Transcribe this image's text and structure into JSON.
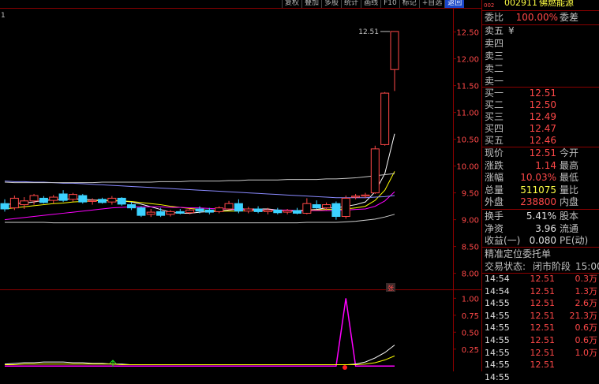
{
  "toolbar": {
    "items": [
      "复权",
      "叠加",
      "多股",
      "统计",
      "画线",
      "F10",
      "标记",
      "+自选",
      "返回"
    ],
    "active_index": 8
  },
  "chart_data": [
    {
      "type": "candlestick",
      "y_ticks": [
        "12.50",
        "12.00",
        "11.50",
        "11.00",
        "10.50",
        "10.00",
        "9.50",
        "9.00",
        "8.50",
        "8.00"
      ],
      "ylim": [
        7.7,
        12.95
      ],
      "price_annotation": "12.51",
      "left_label": "1",
      "marker_label": "张",
      "candles": [
        {
          "o": 9.3,
          "h": 9.38,
          "l": 9.15,
          "c": 9.2
        },
        {
          "o": 9.22,
          "h": 9.45,
          "l": 9.18,
          "c": 9.4
        },
        {
          "o": 9.28,
          "h": 9.42,
          "l": 9.2,
          "c": 9.35
        },
        {
          "o": 9.35,
          "h": 9.48,
          "l": 9.28,
          "c": 9.45
        },
        {
          "o": 9.4,
          "h": 9.44,
          "l": 9.3,
          "c": 9.32
        },
        {
          "o": 9.36,
          "h": 9.46,
          "l": 9.3,
          "c": 9.42
        },
        {
          "o": 9.48,
          "h": 9.55,
          "l": 9.33,
          "c": 9.36
        },
        {
          "o": 9.38,
          "h": 9.5,
          "l": 9.34,
          "c": 9.47
        },
        {
          "o": 9.45,
          "h": 9.48,
          "l": 9.3,
          "c": 9.33
        },
        {
          "o": 9.34,
          "h": 9.4,
          "l": 9.28,
          "c": 9.36
        },
        {
          "o": 9.38,
          "h": 9.41,
          "l": 9.3,
          "c": 9.32
        },
        {
          "o": 9.33,
          "h": 9.44,
          "l": 9.28,
          "c": 9.4
        },
        {
          "o": 9.4,
          "h": 9.42,
          "l": 9.26,
          "c": 9.29
        },
        {
          "o": 9.28,
          "h": 9.33,
          "l": 9.18,
          "c": 9.22
        },
        {
          "o": 9.22,
          "h": 9.25,
          "l": 9.05,
          "c": 9.08
        },
        {
          "o": 9.1,
          "h": 9.2,
          "l": 9.05,
          "c": 9.14
        },
        {
          "o": 9.15,
          "h": 9.22,
          "l": 9.05,
          "c": 9.08
        },
        {
          "o": 9.1,
          "h": 9.18,
          "l": 9.06,
          "c": 9.15
        },
        {
          "o": 9.15,
          "h": 9.2,
          "l": 9.1,
          "c": 9.12
        },
        {
          "o": 9.13,
          "h": 9.2,
          "l": 9.1,
          "c": 9.18
        },
        {
          "o": 9.2,
          "h": 9.25,
          "l": 9.12,
          "c": 9.16
        },
        {
          "o": 9.18,
          "h": 9.22,
          "l": 9.1,
          "c": 9.14
        },
        {
          "o": 9.15,
          "h": 9.25,
          "l": 9.12,
          "c": 9.22
        },
        {
          "o": 9.2,
          "h": 9.35,
          "l": 9.18,
          "c": 9.3
        },
        {
          "o": 9.3,
          "h": 9.38,
          "l": 9.12,
          "c": 9.16
        },
        {
          "o": 9.16,
          "h": 9.24,
          "l": 9.12,
          "c": 9.2
        },
        {
          "o": 9.2,
          "h": 9.25,
          "l": 9.12,
          "c": 9.15
        },
        {
          "o": 9.15,
          "h": 9.22,
          "l": 9.1,
          "c": 9.18
        },
        {
          "o": 9.18,
          "h": 9.22,
          "l": 9.1,
          "c": 9.13
        },
        {
          "o": 9.14,
          "h": 9.2,
          "l": 9.1,
          "c": 9.17
        },
        {
          "o": 9.17,
          "h": 9.22,
          "l": 9.1,
          "c": 9.12
        },
        {
          "o": 9.12,
          "h": 9.4,
          "l": 9.1,
          "c": 9.3
        },
        {
          "o": 9.28,
          "h": 9.36,
          "l": 9.2,
          "c": 9.22
        },
        {
          "o": 9.22,
          "h": 9.32,
          "l": 9.18,
          "c": 9.28
        },
        {
          "o": 9.3,
          "h": 9.34,
          "l": 9.0,
          "c": 9.06
        },
        {
          "o": 9.06,
          "h": 9.45,
          "l": 9.02,
          "c": 9.4
        },
        {
          "o": 9.42,
          "h": 9.48,
          "l": 9.38,
          "c": 9.44
        },
        {
          "o": 9.44,
          "h": 9.5,
          "l": 9.4,
          "c": 9.46
        },
        {
          "o": 9.5,
          "h": 10.38,
          "l": 9.48,
          "c": 10.32
        },
        {
          "o": 10.4,
          "h": 11.38,
          "l": 10.38,
          "c": 11.36
        },
        {
          "o": 11.8,
          "h": 12.51,
          "l": 11.4,
          "c": 12.51
        }
      ],
      "ma_lines": [
        {
          "name": "MA5",
          "color": "#ffffff",
          "values": [
            9.28,
            9.3,
            9.31,
            9.33,
            9.36,
            9.37,
            9.38,
            9.39,
            9.38,
            9.37,
            9.36,
            9.35,
            9.35,
            9.33,
            9.29,
            9.24,
            9.19,
            9.14,
            9.12,
            9.12,
            9.14,
            9.15,
            9.16,
            9.18,
            9.2,
            9.2,
            9.2,
            9.2,
            9.18,
            9.17,
            9.15,
            9.18,
            9.19,
            9.22,
            9.22,
            9.25,
            9.28,
            9.33,
            9.52,
            9.86,
            10.6
          ]
        },
        {
          "name": "MA10",
          "color": "#ffff00",
          "values": [
            9.2,
            9.22,
            9.24,
            9.26,
            9.28,
            9.3,
            9.31,
            9.33,
            9.34,
            9.35,
            9.36,
            9.36,
            9.35,
            9.34,
            9.32,
            9.3,
            9.28,
            9.25,
            9.23,
            9.21,
            9.19,
            9.17,
            9.16,
            9.16,
            9.16,
            9.17,
            9.17,
            9.17,
            9.17,
            9.17,
            9.17,
            9.18,
            9.18,
            9.19,
            9.19,
            9.2,
            9.22,
            9.25,
            9.36,
            9.55,
            9.9
          ]
        },
        {
          "name": "MA20",
          "color": "#ff00ff",
          "values": [
            9.0,
            9.02,
            9.04,
            9.06,
            9.08,
            9.1,
            9.12,
            9.14,
            9.16,
            9.18,
            9.2,
            9.22,
            9.23,
            9.24,
            9.24,
            9.24,
            9.24,
            9.23,
            9.23,
            9.22,
            9.22,
            9.21,
            9.2,
            9.2,
            9.19,
            9.19,
            9.18,
            9.18,
            9.18,
            9.18,
            9.17,
            9.17,
            9.17,
            9.17,
            9.17,
            9.18,
            9.19,
            9.2,
            9.25,
            9.35,
            9.52
          ]
        },
        {
          "name": "MA30",
          "color": "#8a8aff",
          "values": [
            9.72,
            9.71,
            9.71,
            9.7,
            9.7,
            9.69,
            9.68,
            9.68,
            9.67,
            9.66,
            9.65,
            9.64,
            9.63,
            9.62,
            9.61,
            9.6,
            9.59,
            9.58,
            9.57,
            9.56,
            9.55,
            9.54,
            9.53,
            9.52,
            9.51,
            9.5,
            9.49,
            9.48,
            9.47,
            9.46,
            9.45,
            9.44,
            9.43,
            9.42,
            9.41,
            9.41,
            9.41,
            9.41,
            9.42,
            9.43,
            9.45
          ]
        },
        {
          "name": "MA60",
          "color": "#c8c8c8",
          "values": [
            9.7,
            9.69,
            9.69,
            9.69,
            9.69,
            9.69,
            9.69,
            9.69,
            9.69,
            9.69,
            9.7,
            9.7,
            9.7,
            9.7,
            9.7,
            9.7,
            9.71,
            9.71,
            9.71,
            9.72,
            9.72,
            9.72,
            9.72,
            9.73,
            9.73,
            9.74,
            9.74,
            9.74,
            9.74,
            9.75,
            9.75,
            9.75,
            9.75,
            9.76,
            9.76,
            9.77,
            9.78,
            9.8,
            9.82,
            9.84,
            9.86
          ]
        },
        {
          "name": "MA120",
          "color": "#d0d0d0",
          "values": [
            8.95,
            8.95,
            8.95,
            8.95,
            8.95,
            8.94,
            8.94,
            8.94,
            8.94,
            8.94,
            8.94,
            8.94,
            8.94,
            8.94,
            8.94,
            8.94,
            8.94,
            8.94,
            8.94,
            8.94,
            8.94,
            8.94,
            8.94,
            8.94,
            8.94,
            8.94,
            8.94,
            8.94,
            8.94,
            8.94,
            8.94,
            8.95,
            8.95,
            8.95,
            8.95,
            8.96,
            8.97,
            8.99,
            9.01,
            9.05,
            9.1
          ]
        }
      ]
    },
    {
      "type": "line",
      "y_ticks": [
        "1.00",
        "0.75",
        "0.50",
        "0.25"
      ],
      "ylim": [
        -0.02,
        1.12
      ],
      "series": [
        {
          "color": "#ff00ff",
          "values": [
            0,
            0,
            0,
            0,
            0,
            0,
            0,
            0,
            0,
            0,
            0,
            0,
            0,
            0,
            0,
            0,
            0,
            0,
            0,
            0,
            0,
            0,
            0,
            0,
            0,
            0,
            0,
            0,
            0,
            0,
            0,
            0,
            0,
            0,
            0,
            1.0,
            0,
            0,
            0,
            0,
            0
          ]
        },
        {
          "color": "#ffffff",
          "values": [
            0.03,
            0.04,
            0.05,
            0.05,
            0.06,
            0.06,
            0.06,
            0.05,
            0.05,
            0.04,
            0.04,
            0.03,
            0.03,
            0.02,
            0.02,
            0.02,
            0.02,
            0.02,
            0.02,
            0.02,
            0.02,
            0.02,
            0.02,
            0.02,
            0.02,
            0.02,
            0.02,
            0.02,
            0.02,
            0.02,
            0.02,
            0.02,
            0.02,
            0.02,
            0.02,
            0.02,
            0.03,
            0.06,
            0.12,
            0.2,
            0.31
          ]
        },
        {
          "color": "#ffff00",
          "values": [
            0.02,
            0.02,
            0.03,
            0.03,
            0.03,
            0.03,
            0.03,
            0.03,
            0.03,
            0.03,
            0.03,
            0.03,
            0.02,
            0.02,
            0.02,
            0.02,
            0.02,
            0.02,
            0.02,
            0.02,
            0.02,
            0.02,
            0.02,
            0.02,
            0.02,
            0.02,
            0.02,
            0.02,
            0.02,
            0.02,
            0.02,
            0.02,
            0.02,
            0.02,
            0.02,
            0.02,
            0.02,
            0.03,
            0.05,
            0.09,
            0.15
          ]
        }
      ]
    }
  ],
  "quote": {
    "stock_code": "002911",
    "stock_name": "佛燃能源",
    "weibi_label": "委比",
    "weibi_value": "100.00%",
    "weicha_label": "委差",
    "sell_levels": [
      {
        "label": "卖五",
        "price": "",
        "vol": "¥"
      },
      {
        "label": "卖四",
        "price": "",
        "vol": ""
      },
      {
        "label": "卖三",
        "price": "",
        "vol": ""
      },
      {
        "label": "卖二",
        "price": "",
        "vol": ""
      },
      {
        "label": "卖一",
        "price": "",
        "vol": ""
      }
    ],
    "buy_levels": [
      {
        "label": "买一",
        "price": "12.51"
      },
      {
        "label": "买二",
        "price": "12.50"
      },
      {
        "label": "买三",
        "price": "12.49"
      },
      {
        "label": "买四",
        "price": "12.47"
      },
      {
        "label": "买五",
        "price": "12.46"
      }
    ],
    "stats": [
      {
        "l": "现价",
        "v": "12.51",
        "vc": "red",
        "r": "今开"
      },
      {
        "l": "涨跌",
        "v": "1.14",
        "vc": "red",
        "r": "最高"
      },
      {
        "l": "涨幅",
        "v": "10.03%",
        "vc": "red",
        "r": "最低"
      },
      {
        "l": "总量",
        "v": "511075",
        "vc": "yel",
        "r": "量比"
      },
      {
        "l": "外盘",
        "v": "238800",
        "vc": "red",
        "r": "内盘"
      }
    ],
    "stats2": [
      {
        "l": "换手",
        "v": "5.41%",
        "vc": "wh",
        "r": "股本"
      },
      {
        "l": "净资",
        "v": "3.96",
        "vc": "wh",
        "r": "流通"
      },
      {
        "l": "收益(一)",
        "v": "0.080",
        "vc": "wh",
        "r": "PE(动)"
      }
    ],
    "section_title": "精准定位委托单",
    "trade_status_label": "交易状态:",
    "trade_status_value": "闭市阶段",
    "trade_status_time": "15:00:0",
    "ticks": [
      {
        "t": "14:54",
        "p": "12.51",
        "v": "0.3万"
      },
      {
        "t": "14:54",
        "p": "12.51",
        "v": "1.3万"
      },
      {
        "t": "14:55",
        "p": "12.51",
        "v": "2.6万"
      },
      {
        "t": "14:55",
        "p": "12.51",
        "v": "21.3万"
      },
      {
        "t": "14:55",
        "p": "12.51",
        "v": "0.6万"
      },
      {
        "t": "14:55",
        "p": "12.51",
        "v": "0.6万"
      },
      {
        "t": "14:55",
        "p": "12.51",
        "v": "1.0万"
      },
      {
        "t": "14:55",
        "p": "12.51",
        "v": ""
      },
      {
        "t": "14:55",
        "p": "",
        "v": ""
      }
    ]
  }
}
